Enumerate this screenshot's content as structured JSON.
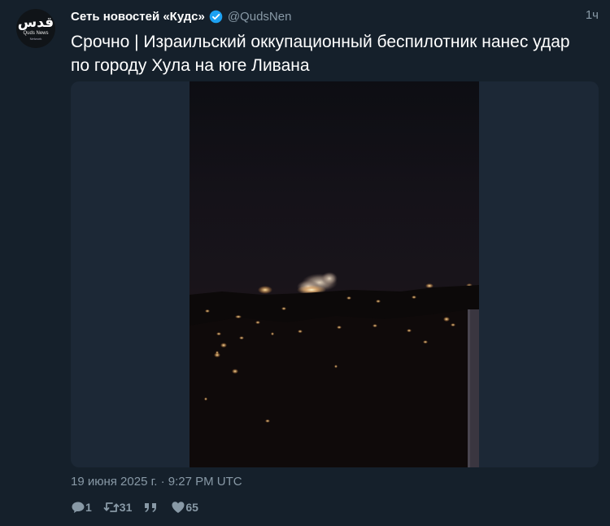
{
  "tweet": {
    "avatar_logo": "قدس",
    "avatar_line1": "Quds News",
    "avatar_line2": "Network",
    "author_name": "Сеть новостей «Кудс»",
    "handle": "@QudsNen",
    "time_ago": "1ч",
    "text": "Срочно | Израильский оккупационный беспилотник нанес удар по городу Хула на юге Ливана",
    "timestamp": "19 июня 2025 г. · 9:27 PM UTC",
    "replies": "1",
    "retweets": "31",
    "likes": "65"
  },
  "colors": {
    "background": "#15202b",
    "secondary_text": "#8899a6",
    "verified_badge": "#1da1f2"
  },
  "icons": [
    "verified-badge-icon",
    "reply-icon",
    "retweet-icon",
    "quote-icon",
    "like-icon"
  ]
}
